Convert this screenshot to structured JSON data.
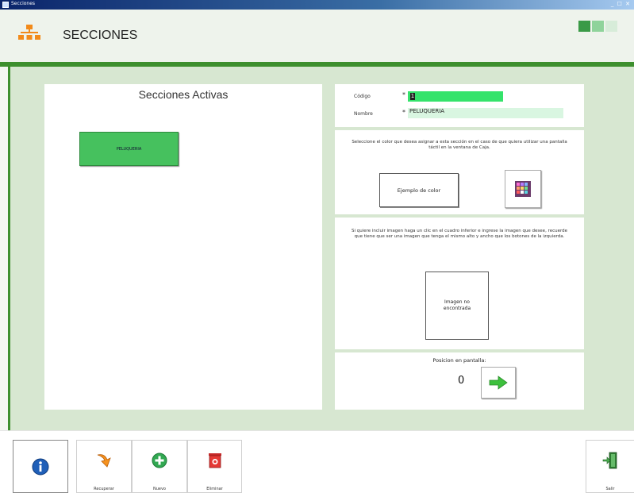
{
  "window": {
    "title": "Secciones",
    "controls": "_ ☐ ✕"
  },
  "header": {
    "title": "SECCIONES",
    "colors": {
      "accent": "#3d8f2e",
      "square_dark": "#3a9a47",
      "square_light": "#8fd39b"
    }
  },
  "left_panel": {
    "title": "Secciones Activas",
    "sections": [
      {
        "label": "PELUQUERIA",
        "color": "#46c15e"
      }
    ]
  },
  "form": {
    "codigo": {
      "label": "Código",
      "required_mark": "*",
      "value": "1"
    },
    "nombre": {
      "label": "Nombre",
      "required_mark": "*",
      "value": "PELUQUERIA"
    }
  },
  "color_section": {
    "description": "Seleccione el color que desea asignar a esta sección en el caso de que quiera utilizar una pantalla táctil en la ventana de Caja.",
    "example_button": "Ejemplo de color",
    "palette_icon": "color-palette-icon"
  },
  "image_section": {
    "description": "Si quiere incluir imagen haga un clic en el cuadro inferior e ingrese la imagen que desee, recuerde que tiene que ser una imagen que tenga el mismo alto y ancho que los botones de la izquierda.",
    "placeholder": "Imagen no encontrada"
  },
  "position_section": {
    "label": "Posicion en pantalla:",
    "value": "0",
    "arrow_icon": "arrow-right-icon"
  },
  "toolbar": {
    "info": {
      "icon": "info-icon"
    },
    "recuperar": {
      "label": "Recuperar",
      "icon": "recover-arrow-icon"
    },
    "nuevo": {
      "label": "Nuevo",
      "icon": "add-icon"
    },
    "eliminar": {
      "label": "Eliminar",
      "icon": "trash-icon"
    },
    "salir": {
      "label": "Salir",
      "icon": "exit-door-icon"
    }
  }
}
